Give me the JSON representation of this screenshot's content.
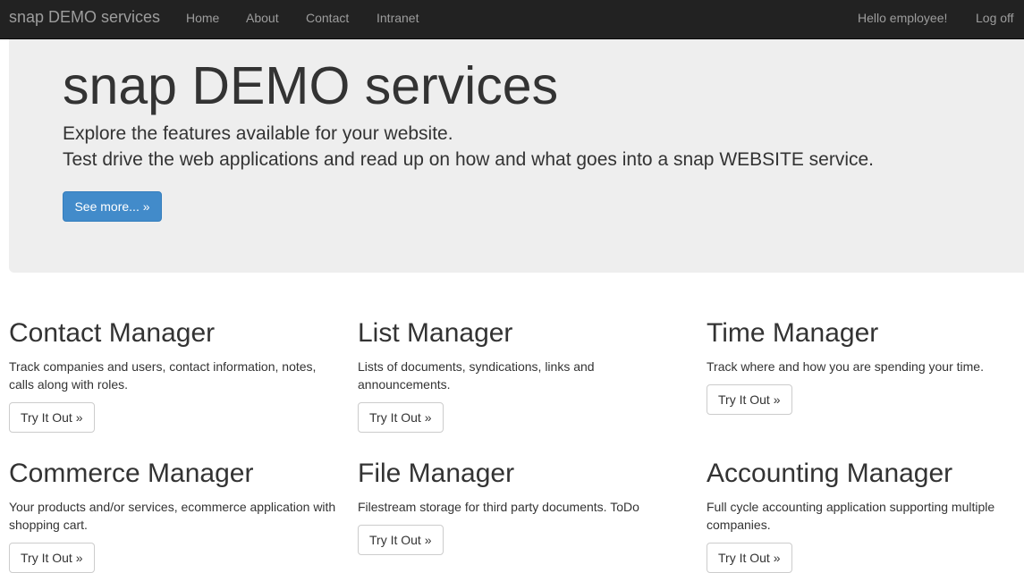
{
  "navbar": {
    "brand": "snap DEMO services",
    "links": [
      "Home",
      "About",
      "Contact",
      "Intranet"
    ],
    "greeting": "Hello employee!",
    "logoff": "Log off"
  },
  "hero": {
    "title": "snap DEMO services",
    "lead_line1": "Explore the features available for your website.",
    "lead_line2": "Test drive the web applications and read up on how and what goes into a snap WEBSITE service.",
    "button": "See more... »"
  },
  "tiles": [
    {
      "title": "Contact Manager",
      "description": "Track companies and users, contact information, notes, calls along with roles.",
      "button": "Try It Out »"
    },
    {
      "title": "List Manager",
      "description": "Lists of documents, syndications, links and announcements.",
      "button": "Try It Out »"
    },
    {
      "title": "Time Manager",
      "description": "Track where and how you are spending your time.",
      "button": "Try It Out »"
    },
    {
      "title": "Commerce Manager",
      "description": "Your products and/or services, ecommerce application with shopping cart.",
      "button": "Try It Out »"
    },
    {
      "title": "File Manager",
      "description": "Filestream storage for third party documents. ToDo",
      "button": "Try It Out »"
    },
    {
      "title": "Accounting Manager",
      "description": "Full cycle accounting application supporting multiple companies.",
      "button": "Try It Out »"
    }
  ],
  "colors": {
    "navbar_bg": "#222222",
    "nav_text": "#9d9d9d",
    "jumbotron_bg": "#eeeeee",
    "primary": "#428bca"
  }
}
